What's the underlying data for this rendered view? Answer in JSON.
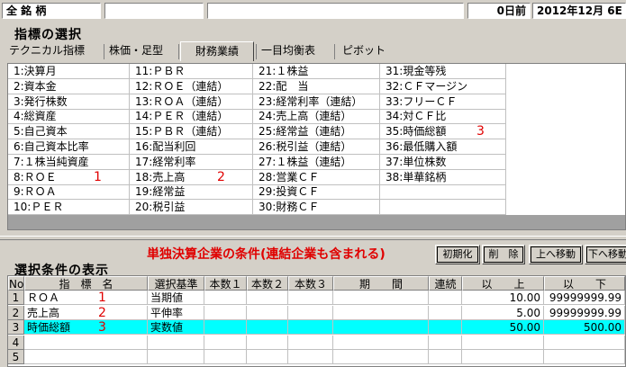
{
  "topbar": {
    "field1": "全 銘 柄",
    "field2": "",
    "field3": "",
    "days": "0日前",
    "date": "2012年12月 6E"
  },
  "indicator_section": {
    "title": "指標の選択",
    "tabs": [
      {
        "label": "テクニカル指標",
        "active": false
      },
      {
        "label": "株価・足型",
        "active": false
      },
      {
        "label": "財務業績",
        "active": true
      },
      {
        "label": "一目均衡表",
        "active": false
      },
      {
        "label": "ピボット",
        "active": false
      }
    ],
    "columns": [
      [
        "1:決算月",
        "2:資本金",
        "3:発行株数",
        "4:総資産",
        "5:自己資本",
        "6:自己資本比率",
        "7:１株当純資産",
        "8:ＲＯＥ",
        "9:ＲＯＡ",
        "10:ＰＥＲ"
      ],
      [
        "11:ＰＢＲ",
        "12:ＲＯＥ（連結）",
        "13:ＲＯＡ（連結）",
        "14:ＰＥＲ（連結）",
        "15:ＰＢＲ（連結）",
        "16:配当利回",
        "17:経常利率",
        "18:売上高",
        "19:経常益",
        "20:税引益"
      ],
      [
        "21:１株益",
        "22:配　当",
        "23:経常利率（連結）",
        "24:売上高（連結）",
        "25:経常益（連結）",
        "26:税引益（連結）",
        "27:１株益（連結）",
        "28:営業ＣＦ",
        "29:投資ＣＦ",
        "30:財務ＣＦ"
      ],
      [
        "31:現金等残",
        "32:ＣＦマージン",
        "33:フリーＣＦ",
        "34:対ＣＦ比",
        "35:時価総額",
        "36:最低購入額",
        "37:単位株数",
        "38:単華銘柄",
        "",
        ""
      ]
    ],
    "marks": [
      {
        "text": "1",
        "col": 0,
        "row": 7
      },
      {
        "text": "2",
        "col": 1,
        "row": 7
      },
      {
        "text": "3",
        "col": 3,
        "row": 4
      }
    ]
  },
  "buttons": {
    "init": "初期化",
    "delete": "削　除",
    "up": "上へ移動",
    "down": "下へ移動"
  },
  "condition_section": {
    "title": "選択条件の表示",
    "note": "単独決算企業の条件(連結企業も含まれる)",
    "headers": [
      "No",
      "指　標　名",
      "選択基準",
      "本数１",
      "本数２",
      "本数３",
      "期　　間",
      "連続",
      "以　　上",
      "以　　下"
    ],
    "rows": [
      {
        "no": "1",
        "name": "ＲＯＡ",
        "mark": "1",
        "criteria": "当期値",
        "min": "10.00",
        "max": "99999999.99",
        "selected": false
      },
      {
        "no": "2",
        "name": "売上高",
        "mark": "2",
        "criteria": "平伸率",
        "min": "5.00",
        "max": "99999999.99",
        "selected": false
      },
      {
        "no": "3",
        "name": "時価総額",
        "mark": "3",
        "criteria": "実数値",
        "min": "50.00",
        "max": "500.00",
        "selected": true
      },
      {
        "no": "4",
        "name": "",
        "mark": "",
        "criteria": "",
        "min": "",
        "max": "",
        "selected": false
      },
      {
        "no": "5",
        "name": "",
        "mark": "",
        "criteria": "",
        "min": "",
        "max": "",
        "selected": false
      }
    ]
  },
  "colors": {
    "window_bg": "#d4d0c8",
    "highlight": "#00ffff",
    "annotation_red": "#e00000"
  }
}
